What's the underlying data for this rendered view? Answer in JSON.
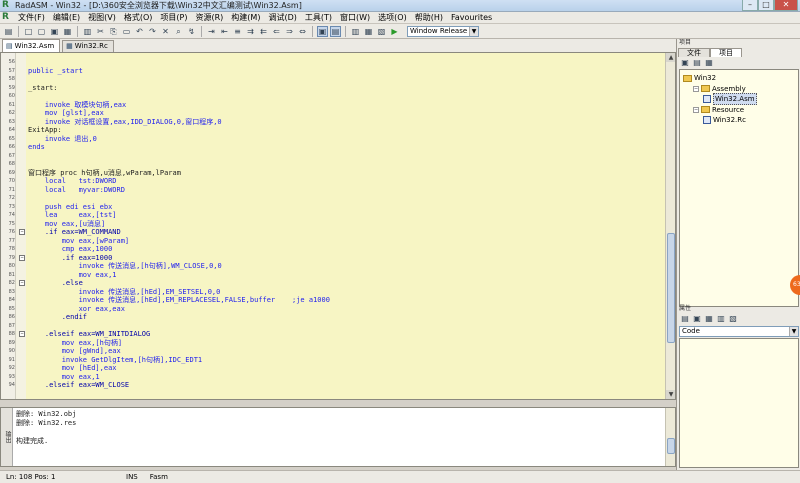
{
  "window": {
    "title": "RadASM - Win32 - [D:\\360安全浏览器下载\\Win32中文汇编测试\\Win32.Asm]",
    "app_icon_glyph": "R",
    "min_glyph": "–",
    "max_glyph": "□",
    "close_glyph": "✕"
  },
  "menu": {
    "icon_glyph": "R",
    "items": [
      "文件(F)",
      "编辑(E)",
      "视图(V)",
      "格式(O)",
      "项目(P)",
      "资源(R)",
      "构建(M)",
      "调试(D)",
      "工具(T)",
      "窗口(W)",
      "选项(O)",
      "帮助(H)",
      "Favourites"
    ],
    "right_glyphs": [
      "–",
      "□",
      "✕"
    ]
  },
  "toolbar": {
    "build_config": "Window Release",
    "glyphs": [
      "▤",
      "□",
      "▢",
      "▣",
      "▦",
      "▥",
      "✂",
      "⎘",
      "▭",
      "↶",
      "↷",
      "✕",
      "⌕",
      "↯",
      "⇥",
      "⇤",
      "≡",
      "⇉",
      "⇇",
      "⇐",
      "⇒",
      "⇔",
      "▣",
      "▤",
      "▥",
      "▦",
      "▧",
      "▶"
    ],
    "combo_arrow": "▼"
  },
  "tabs": [
    {
      "label": "Win32.Asm",
      "icon": "▤"
    },
    {
      "label": "Win32.Rc",
      "icon": "▦"
    }
  ],
  "editor": {
    "fold_glyph": "−",
    "scroll_up": "▲",
    "scroll_down": "▼",
    "lines": [
      {
        "n": "56",
        "t": ""
      },
      {
        "n": "57",
        "t": "public _start"
      },
      {
        "n": "58",
        "t": ""
      },
      {
        "n": "59",
        "t": "_start:"
      },
      {
        "n": "60",
        "t": ""
      },
      {
        "n": "61",
        "t": "    invoke 取模块句柄,eax"
      },
      {
        "n": "62",
        "t": "    mov [glst],eax"
      },
      {
        "n": "63",
        "t": "    invoke 对话框设置,eax,IDD_DIALOG,0,窗口程序,0"
      },
      {
        "n": "64",
        "t": "ExitApp:"
      },
      {
        "n": "65",
        "t": "    invoke 退出,0"
      },
      {
        "n": "66",
        "t": "ends"
      },
      {
        "n": "67",
        "t": ""
      },
      {
        "n": "68",
        "t": ""
      },
      {
        "n": "69",
        "t": "窗口程序 proc h句柄,u消息,wParam,lParam"
      },
      {
        "n": "70",
        "t": "    local   tst:DWORD"
      },
      {
        "n": "71",
        "t": "    local   myvar:DWORD"
      },
      {
        "n": "72",
        "t": ""
      },
      {
        "n": "73",
        "t": "    push edi esi ebx"
      },
      {
        "n": "74",
        "t": "    lea     eax,[tst]"
      },
      {
        "n": "75",
        "t": "    mov eax,[u消息]"
      },
      {
        "n": "76",
        "t": "    .if eax=WM_COMMAND",
        "fold": true
      },
      {
        "n": "77",
        "t": "        mov eax,[wParam]"
      },
      {
        "n": "78",
        "t": "        cmp eax,1000"
      },
      {
        "n": "79",
        "t": "        .if eax=1000",
        "fold": true
      },
      {
        "n": "80",
        "t": "            invoke 传送消息,[h句柄],WM_CLOSE,0,0"
      },
      {
        "n": "81",
        "t": "            mov eax,1"
      },
      {
        "n": "82",
        "t": "        .else",
        "fold": true
      },
      {
        "n": "83",
        "t": "            invoke 传送消息,[hEd],EM_SETSEL,0,0"
      },
      {
        "n": "84",
        "t": "            invoke 传送消息,[hEd],EM_REPLACESEL,FALSE,buffer    ;je a1000"
      },
      {
        "n": "85",
        "t": "            xor eax,eax"
      },
      {
        "n": "86",
        "t": "        .endif"
      },
      {
        "n": "87",
        "t": ""
      },
      {
        "n": "88",
        "t": "    .elseif eax=WM_INITDIALOG",
        "fold": true
      },
      {
        "n": "89",
        "t": "        mov eax,[h句柄]"
      },
      {
        "n": "90",
        "t": "        mov [gWnd],eax"
      },
      {
        "n": "91",
        "t": "        invoke GetDlgItem,[h句柄],IDC_EDT1"
      },
      {
        "n": "92",
        "t": "        mov [hEd],eax"
      },
      {
        "n": "93",
        "t": "        mov eax,1"
      },
      {
        "n": "94",
        "t": "    .elseif eax=WM_CLOSE"
      }
    ]
  },
  "output": {
    "side_label": "输出",
    "lines": [
      "删除: Win32.obj",
      "删除: Win32.res",
      "",
      "构建完成."
    ]
  },
  "statusbar": {
    "position": "Ln: 108  Pos: 1",
    "mode": "INS",
    "assembler": "Fasm"
  },
  "project_panel": {
    "title": "项目",
    "tabs": [
      "文件",
      "项目"
    ],
    "tool_glyphs": [
      "▣",
      "▤",
      "▦"
    ],
    "tree": [
      {
        "label": "Win32",
        "type": "folder",
        "level": 0
      },
      {
        "label": "Assembly",
        "type": "folder",
        "level": 1,
        "exp": "−"
      },
      {
        "label": "Win32.Asm",
        "type": "file",
        "level": 2,
        "selected": true
      },
      {
        "label": "Resource",
        "type": "folder",
        "level": 1,
        "exp": "−"
      },
      {
        "label": "Win32.Rc",
        "type": "file",
        "level": 2
      }
    ]
  },
  "properties_panel": {
    "title": "属性",
    "tool_glyphs": [
      "▤",
      "▣",
      "▦",
      "▥",
      "▧"
    ],
    "selected": "Code",
    "combo_arrow": "▼"
  },
  "float_badge": "63"
}
